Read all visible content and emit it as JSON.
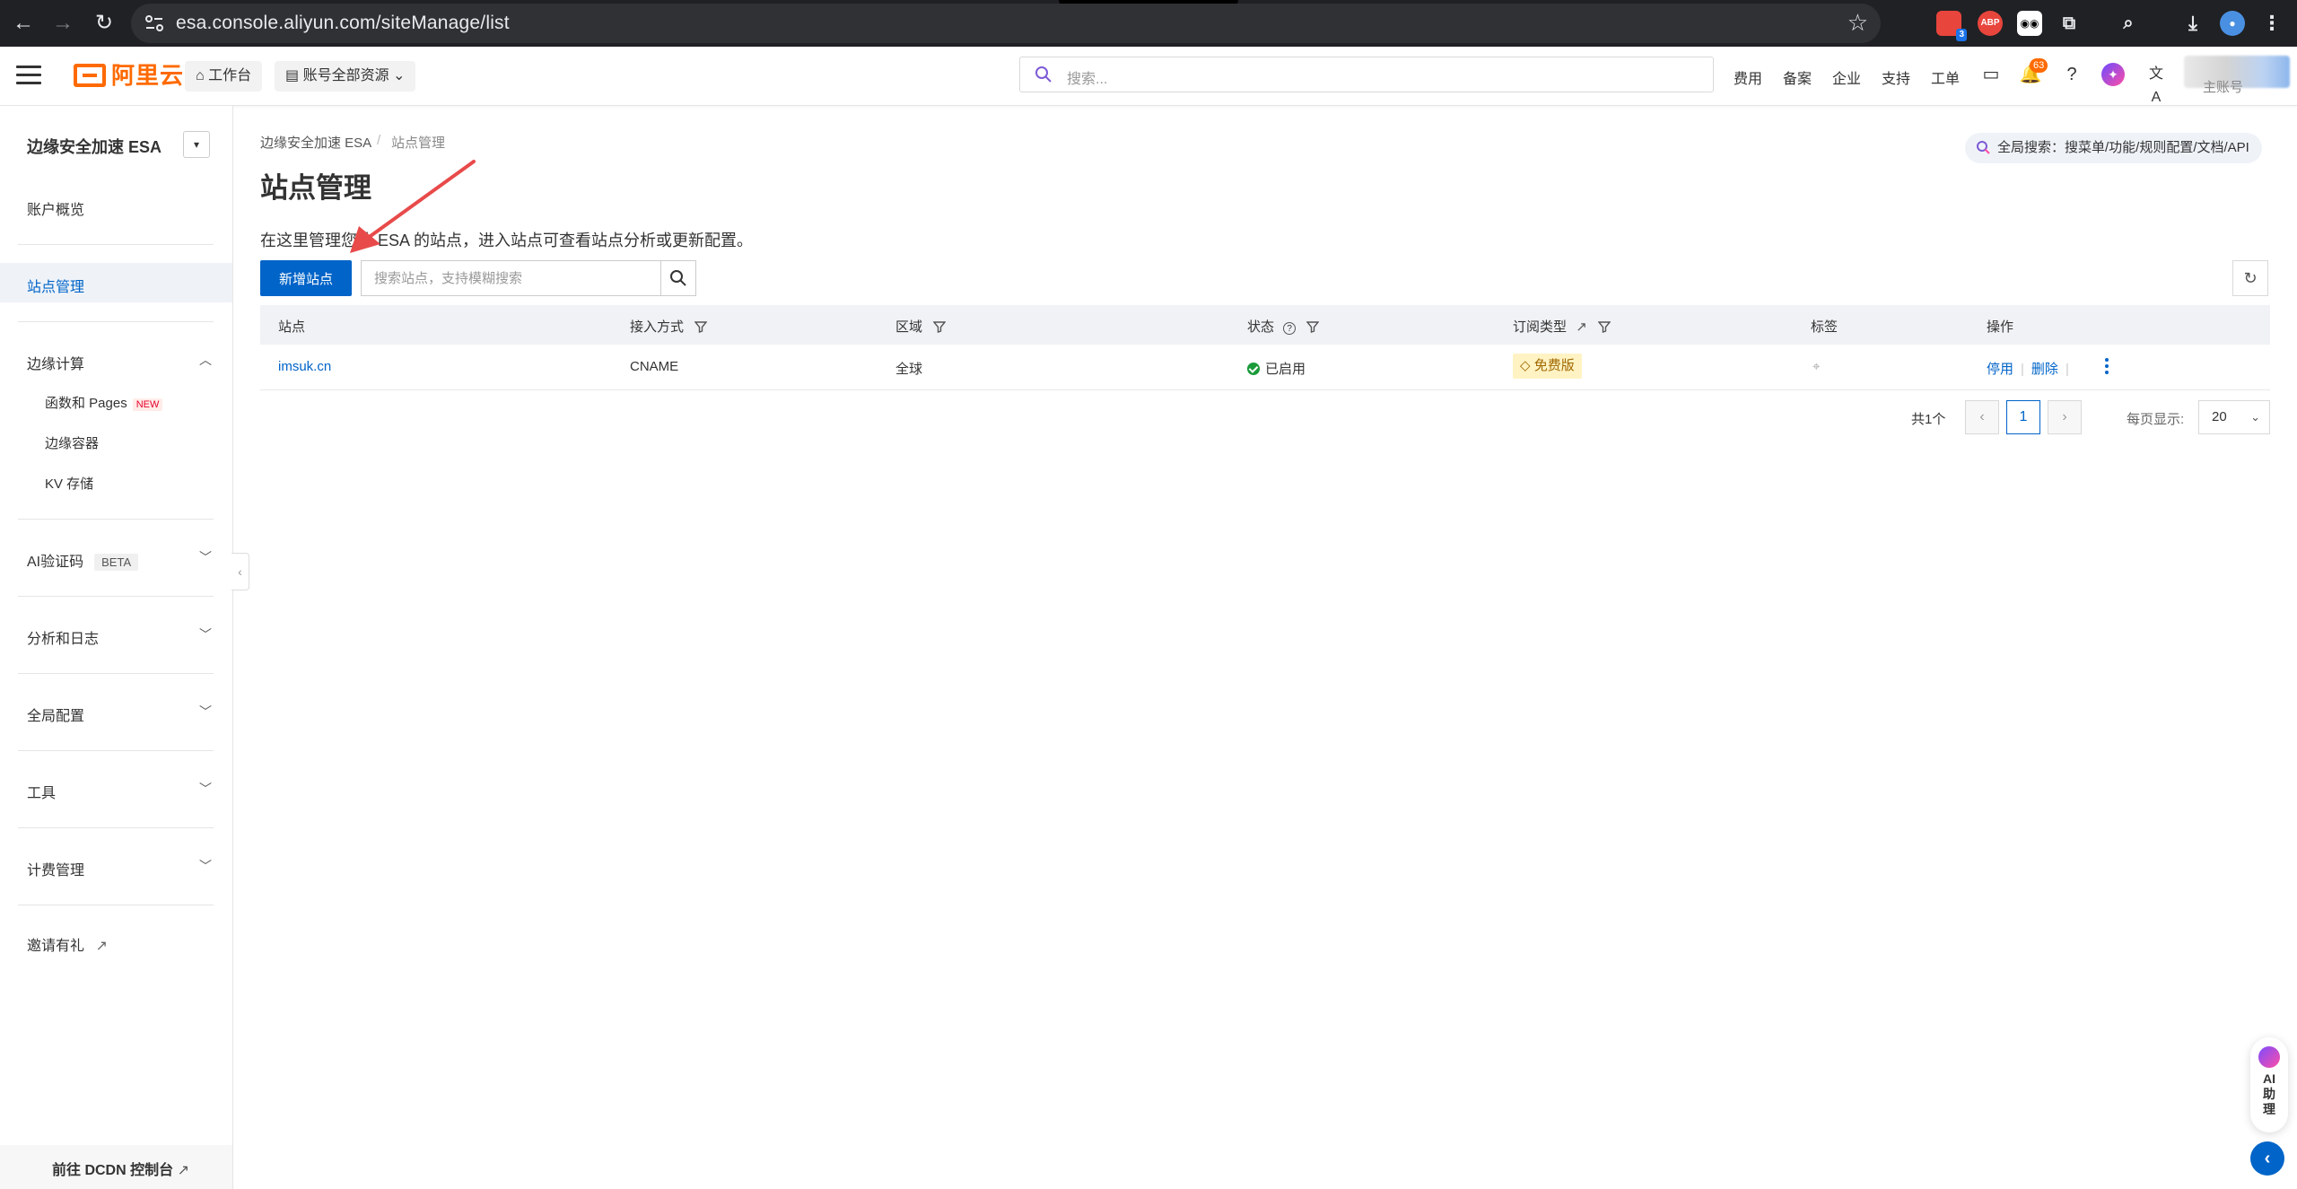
{
  "browser": {
    "url": "esa.console.aliyun.com/siteManage/list",
    "ext_badge": "3",
    "abp_label": "ABP"
  },
  "topbar": {
    "logo": "阿里云",
    "workbench": "工作台",
    "resources": "账号全部资源",
    "search_placeholder": "搜索...",
    "nav": [
      "费用",
      "备案",
      "企业",
      "支持",
      "工单"
    ],
    "notification_count": "63",
    "account_label": "主账号"
  },
  "sidebar": {
    "title": "边缘安全加速 ESA",
    "overview": "账户概览",
    "site_management": "站点管理",
    "edge_compute": "边缘计算",
    "functions_pages": "函数和 Pages",
    "new_tag": "NEW",
    "edge_container": "边缘容器",
    "kv_storage": "KV 存储",
    "ai_captcha": "AI验证码",
    "beta_tag": "BETA",
    "analytics_logs": "分析和日志",
    "global_config": "全局配置",
    "tools": "工具",
    "billing": "计费管理",
    "invite": "邀请有礼",
    "dcdn": "前往 DCDN 控制台"
  },
  "main": {
    "breadcrumb": [
      "边缘安全加速 ESA",
      "站点管理"
    ],
    "breadcrumb_sep": "/",
    "title": "站点管理",
    "description": "在这里管理您的 ESA 的站点，进入站点可查看站点分析或更新配置。",
    "global_search": "全局搜索：搜菜单/功能/规则配置/文档/API",
    "add_site": "新增站点",
    "site_search_placeholder": "搜索站点，支持模糊搜索",
    "columns": [
      "站点",
      "接入方式",
      "区域",
      "状态",
      "订阅类型",
      "标签",
      "操作"
    ],
    "rows": [
      {
        "site": "imsuk.cn",
        "access": "CNAME",
        "region": "全球",
        "status": "已启用",
        "plan": "免费版",
        "ops": [
          "停用",
          "删除"
        ]
      }
    ],
    "pagination": {
      "total": "共1个",
      "current": "1",
      "per_page_label": "每页显示:",
      "per_page": "20"
    }
  },
  "ai_helper": {
    "label": [
      "AI",
      "助",
      "理"
    ]
  },
  "colors": {
    "brand": "#ff6a00",
    "primary": "#0064c8",
    "success": "#1a9b3a",
    "annotation": "#e84a4a"
  }
}
